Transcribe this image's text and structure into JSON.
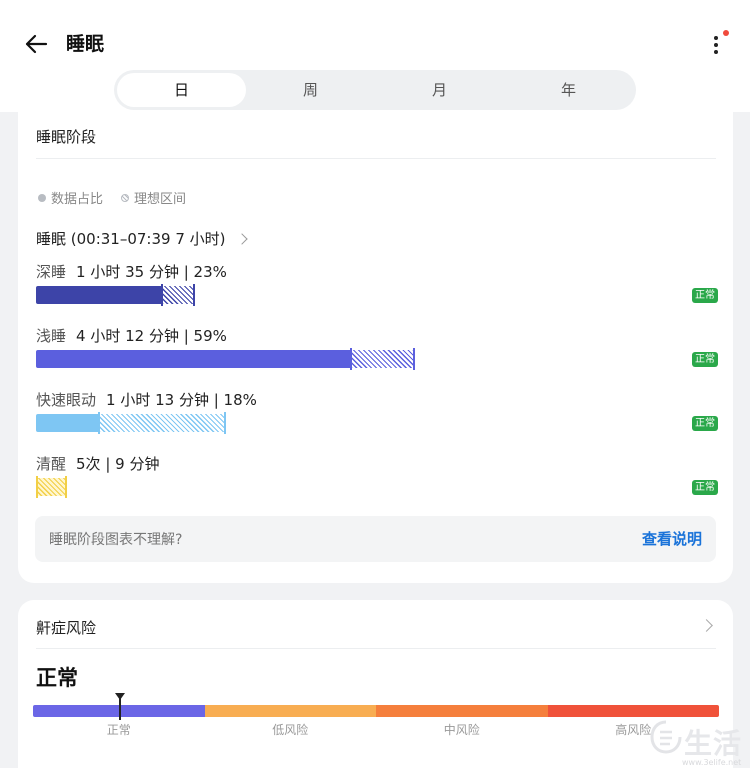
{
  "header": {
    "title": "睡眠",
    "tabs": [
      {
        "label": "日",
        "active": true
      },
      {
        "label": "周",
        "active": false
      },
      {
        "label": "月",
        "active": false
      },
      {
        "label": "年",
        "active": false
      }
    ]
  },
  "sleep_stages": {
    "title": "睡眠阶段",
    "legend": {
      "data_ratio": "数据占比",
      "ideal_range": "理想区间"
    },
    "summary": "睡眠 (00:31–07:39 7 小时)",
    "stages": [
      {
        "name": "深睡",
        "value": "1 小时 35 分钟 | 23%",
        "badge": "正常",
        "percent": 23,
        "color": "#3d44a8",
        "hatch_color": "#3d44a8"
      },
      {
        "name": "浅睡",
        "value": "4 小时 12 分钟 | 59%",
        "badge": "正常",
        "percent": 59,
        "color": "#5b5fde",
        "hatch_color": "#5b5fde"
      },
      {
        "name": "快速眼动",
        "value": "1 小时 13 分钟 | 18%",
        "badge": "正常",
        "percent": 18,
        "color": "#7ec6f3",
        "hatch_color": "#7ec6f3"
      },
      {
        "name": "清醒",
        "value": "5次 |  9 分钟",
        "badge": "正常",
        "percent": null,
        "color": "#f2cf46",
        "hatch_color": "#f2cf46"
      }
    ],
    "help_text": "睡眠阶段图表不理解?",
    "help_link": "查看说明"
  },
  "snore_risk": {
    "title": "鼾症风险",
    "status": "正常",
    "levels": [
      "正常",
      "低风险",
      "中风险",
      "高风险"
    ],
    "colors": [
      "#6b66e6",
      "#f8ad52",
      "#f57f3c",
      "#f0523a"
    ]
  },
  "watermark": {
    "text": "生活",
    "url": "www.3elife.net"
  }
}
